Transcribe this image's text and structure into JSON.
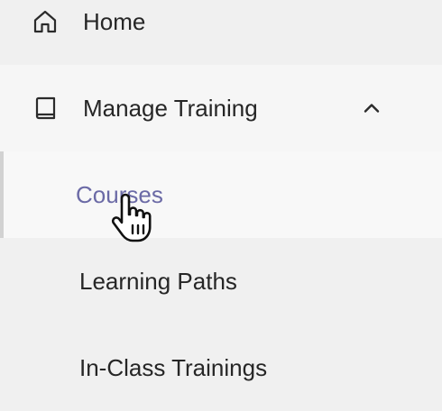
{
  "nav": {
    "home": {
      "label": "Home",
      "icon": "home-icon"
    },
    "manage_training": {
      "label": "Manage Training",
      "icon": "book-icon",
      "expanded": true,
      "toggle_icon": "chevron-up-icon",
      "children": [
        {
          "label": "Courses",
          "active": true
        },
        {
          "label": "Learning Paths",
          "active": false
        },
        {
          "label": "In-Class Trainings",
          "active": false
        }
      ]
    }
  },
  "colors": {
    "active_text": "#6b6aa6",
    "text": "#262626",
    "background": "#f0f0f0",
    "active_indicator": "#d2d2d2"
  },
  "cursor": {
    "icon": "hand-pointer-icon"
  }
}
